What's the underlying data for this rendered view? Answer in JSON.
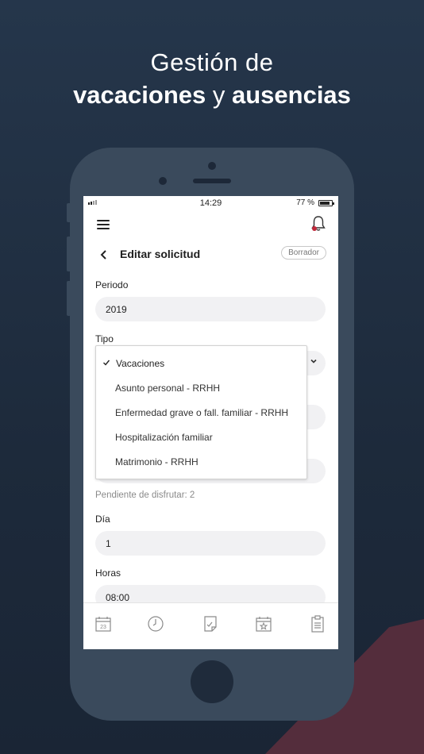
{
  "headline": {
    "line1": "Gestión de",
    "word1": "vacaciones",
    "connector": "y",
    "word2": "ausencias"
  },
  "status_bar": {
    "time": "14:29",
    "battery": "77 %"
  },
  "header": {
    "title": "Editar solicitud",
    "status_badge": "Borrador"
  },
  "form": {
    "periodo_label": "Periodo",
    "periodo_value": "2019",
    "tipo_label": "Tipo",
    "pending_text": "Pendiente de disfrutar: 2",
    "dia_label": "Día",
    "dia_value": "1",
    "horas_label": "Horas",
    "horas_value": "08:00"
  },
  "dropdown": {
    "selected": "Vacaciones",
    "options": [
      "Vacaciones",
      "Asunto personal - RRHH",
      "Enfermedad grave o fall. familiar - RRHH",
      "Hospitalización familiar",
      "Matrimonio - RRHH"
    ]
  },
  "tabbar": {
    "icons": [
      "calendar-23-icon",
      "clock-icon",
      "document-check-icon",
      "calendar-star-icon",
      "clipboard-icon"
    ],
    "calendar_day": "23"
  },
  "colors": {
    "background": "#1f2c3e",
    "phone": "#3a4a5c",
    "accent": "#5b2f3d",
    "bell_dot": "#c0283a"
  }
}
